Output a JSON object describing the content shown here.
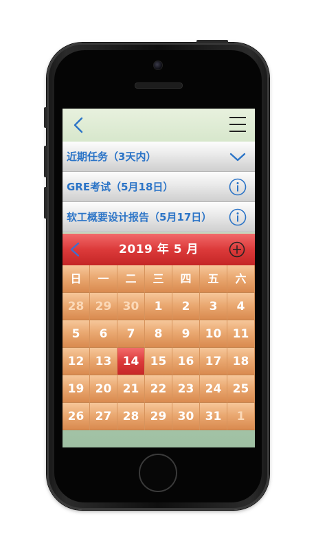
{
  "topbar": {},
  "tasks": [
    {
      "label": "近期任务（3天内）",
      "icon": "chevron-down-icon"
    },
    {
      "label": "GRE考试（5月18日）",
      "icon": "info-icon"
    },
    {
      "label": "软工概要设计报告（5月17日）",
      "icon": "info-icon"
    }
  ],
  "calendar": {
    "title": "2019 年 5 月",
    "weekdays": [
      "日",
      "一",
      "二",
      "三",
      "四",
      "五",
      "六"
    ],
    "weeks": [
      [
        "28",
        "29",
        "30",
        "1",
        "2",
        "3",
        "4"
      ],
      [
        "5",
        "6",
        "7",
        "8",
        "9",
        "10",
        "11"
      ],
      [
        "12",
        "13",
        "14",
        "15",
        "16",
        "17",
        "18"
      ],
      [
        "19",
        "20",
        "21",
        "22",
        "23",
        "24",
        "25"
      ],
      [
        "26",
        "27",
        "28",
        "29",
        "30",
        "31",
        "1"
      ]
    ],
    "today": "14",
    "colors": {
      "header": "#dc3a3a",
      "cell": "#eaa972",
      "accent": "#2b74c7"
    }
  }
}
